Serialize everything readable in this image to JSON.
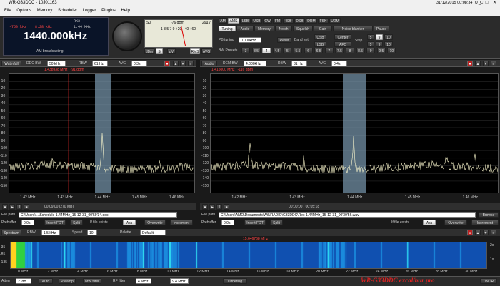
{
  "window": {
    "title": "WR-G33DDC - 10J01163",
    "clock": "31/12/2015 00:08:34 (UTC)",
    "min": "_",
    "max": "□",
    "close": "✕"
  },
  "menu": [
    "File",
    "Options",
    "Memory",
    "Scheduler",
    "Logger",
    "Plugins",
    "Help"
  ],
  "freq": {
    "rx_label": "RX3",
    "left_lo": "-750 kHz",
    "left_bw": "8.28 kHz",
    "right_bw": "1.44 MHz",
    "main": "1440.000kHz",
    "station": "AM broadcasting"
  },
  "smeter": {
    "s": "S0",
    "level": "-76 dBm",
    "uv": "29µV",
    "scale": "1 3 5 7 9 +20 +40 +60",
    "dbm": "dBm",
    "s_btn": "S",
    "uv_btn": "µV",
    "rms": "RMS",
    "avg": "AVG"
  },
  "modes": [
    "AM",
    "AMS",
    "LSB",
    "USB",
    "CW",
    "FM",
    "ISB",
    "DSB",
    "DRM",
    "FSK",
    "UDM",
    "Pause"
  ],
  "tabs": [
    "Tuning",
    "Audio",
    "Memory",
    "Notch",
    "Squelch",
    "Gain",
    "Noise blanker"
  ],
  "tuning": {
    "pb_label": "PB tuning",
    "pb_value": "0.000kHz",
    "reset": "Reset",
    "bandset": "Band set",
    "lsb": "LSB",
    "usb": "USB",
    "center": "Center",
    "afc": "AFC",
    "step": "Step",
    "bw_presets": "BW Presets",
    "presets": [
      "3",
      "3.5",
      "4",
      "4.5",
      "5",
      "5.5",
      "6",
      "6.5",
      "7",
      "7.5",
      "8",
      "8.5",
      "9",
      "9.5",
      "10"
    ],
    "steps": [
      "5",
      "9",
      "10"
    ]
  },
  "left": {
    "tab": "Waterfall",
    "ddc": "DDC BW",
    "ddc_v": "50 kHz",
    "rbw": "RBW",
    "rbw_v": "61 Hz",
    "avg": "AVG",
    "avg_v": "0.3s",
    "marker": "1.438938 MHz ; -91 dBm",
    "yticks": [
      "-10",
      "-20",
      "-30",
      "-40",
      "-50",
      "-60",
      "-70",
      "-80",
      "-90",
      "-100",
      "-110",
      "-120",
      "-130",
      "-140",
      "-150"
    ],
    "xticks": [
      "1.42 MHz",
      "1.43 MHz",
      "1.44 MHz",
      "1.45 MHz",
      "1.46 MHz"
    ],
    "time": "00:09:00 [270 MB]",
    "filepath_label": "File path",
    "filepath": "C:\\Users\\...\\Schedule-1.44MHz_15-12-31_00'59'34.ddc",
    "prebuf": "Prebuffer",
    "prebuf_v": "0.0s",
    "insert": "Insert FDT",
    "split": "Split",
    "ifexists": "If file exists",
    "ask": "Ask",
    "overwrite": "Overwrite",
    "increment": "Increment"
  },
  "right": {
    "tab": "Audio",
    "dem": "DEM BW",
    "dem_v": "4.000kHz",
    "rbw": "RBW",
    "rbw_v": "31 Hz",
    "avg": "AVG",
    "avg_v": "0.4s",
    "marker": "1.415000 MHz ; -116 dBm",
    "yticks": [
      "-10",
      "-20",
      "-30",
      "-40",
      "-50",
      "-60",
      "-70",
      "-80",
      "-90",
      "-100",
      "-110",
      "-120",
      "-130",
      "-140",
      "-150"
    ],
    "xticks": [
      "1.42 MHz",
      "1.43 MHz",
      "1.44 MHz",
      "1.45 MHz",
      "1.46 MHz"
    ],
    "time": "00:00:00 / 00:05:18",
    "filepath_label": "File path",
    "filepath": "C:\\Users\\AMO\\Documents\\WiNRADIO\\G33DDC\\Rec-1.44MHz_15-12-31_00'39'56.wav",
    "browse": "Browse",
    "prebuf": "Prebuffer",
    "prebuf_v": "0.0s",
    "insert": "Insert FDT",
    "split": "Split",
    "ifexists": "If file exists",
    "ask": "Ask",
    "overwrite": "Overwrite",
    "increment": "Increment"
  },
  "spectrum": {
    "tab": "Spectrum",
    "rbw": "RBW",
    "rbw_v": "1.5 kHz",
    "speed": "Speed",
    "speed_v": "10",
    "palette": "Palette",
    "palette_v": "Default",
    "marker": "15.646768 MHz",
    "yticks": [
      "-35",
      "-85",
      "-135"
    ],
    "xticks": [
      "0 MHz",
      "2 MHz",
      "4 MHz",
      "6 MHz",
      "8 MHz",
      "10 MHz",
      "12 MHz",
      "14 MHz",
      "16 MHz",
      "18 MHz",
      "20 MHz",
      "22 MHz",
      "24 MHz",
      "26 MHz",
      "28 MHz",
      "30 MHz"
    ],
    "zoom": [
      "2x",
      "1x"
    ]
  },
  "bottom": {
    "atten": "Atten",
    "atten_v": "21dB",
    "auto": "Auto",
    "preamp": "Preamp",
    "mw": "MW filter",
    "rf": "RF filter",
    "rf_v": "4 MHz",
    "rf2": "9.4 MHz",
    "dither": "Dithering",
    "logo": "WR-G33DDC excalibur pro",
    "dndr": "DNDR"
  },
  "colors": {
    "trace": "#fffbd0",
    "passband": "#7a9ab0",
    "marker": "#ff3030"
  }
}
